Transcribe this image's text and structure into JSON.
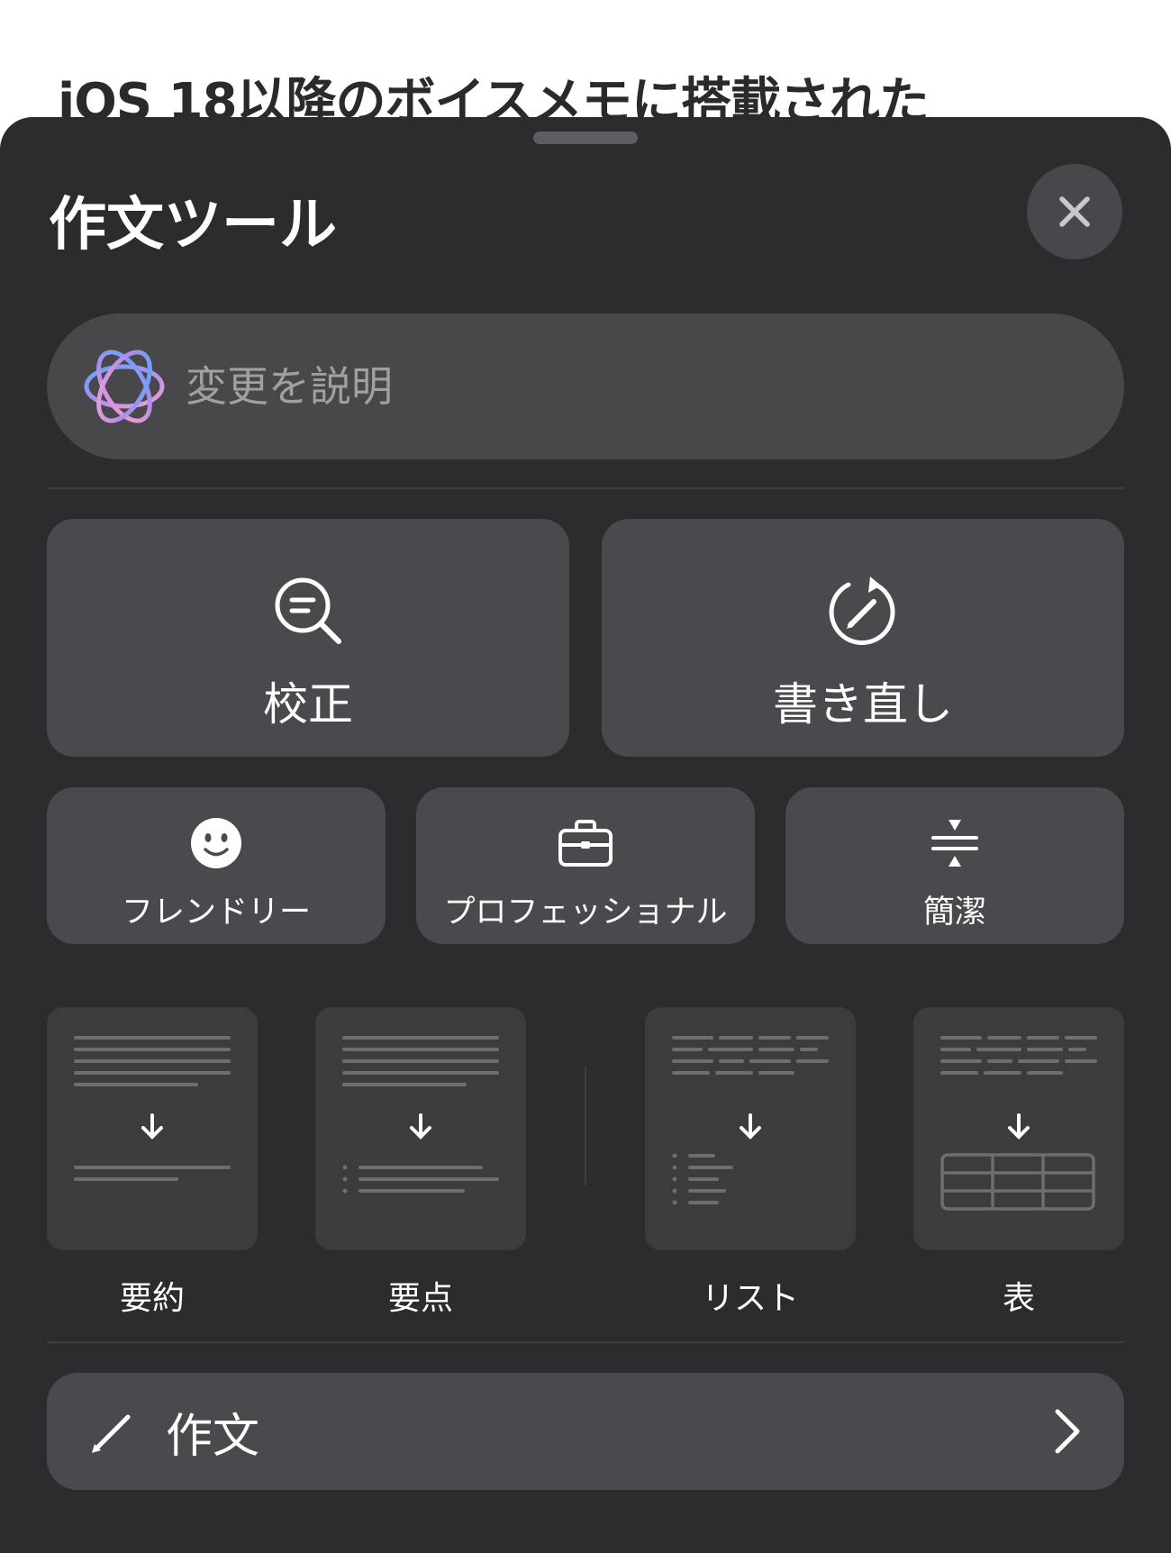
{
  "background_article": {
    "title": "iOS 18以降のボイスメモに搭載された"
  },
  "sheet": {
    "title": "作文ツール",
    "close_icon": "xmark-icon",
    "describe": {
      "placeholder": "変更を説明",
      "icon": "apple-intelligence-icon"
    }
  },
  "primary_tools": [
    {
      "label": "校正",
      "icon": "magnifier-text-icon"
    },
    {
      "label": "書き直し",
      "icon": "rewrite-circle-pencil-icon"
    }
  ],
  "tone_tools": [
    {
      "label": "フレンドリー",
      "icon": "smiley-face-icon"
    },
    {
      "label": "プロフェッショナル",
      "icon": "briefcase-icon"
    },
    {
      "label": "簡潔",
      "icon": "compress-arrows-icon"
    }
  ],
  "transform_tools": [
    {
      "label": "要約",
      "icon": "summary-doc-icon"
    },
    {
      "label": "要点",
      "icon": "key-points-doc-icon"
    },
    {
      "label": "リスト",
      "icon": "list-doc-icon"
    },
    {
      "label": "表",
      "icon": "table-doc-icon"
    }
  ],
  "compose": {
    "label": "作文",
    "icon": "pencil-icon",
    "chevron": "chevron-right-icon"
  },
  "colors": {
    "sheet": "#2c2c2e",
    "button": "#4a4a4e",
    "field": "#48484b",
    "text": "#ffffff",
    "placeholder": "#a0a0a4"
  }
}
